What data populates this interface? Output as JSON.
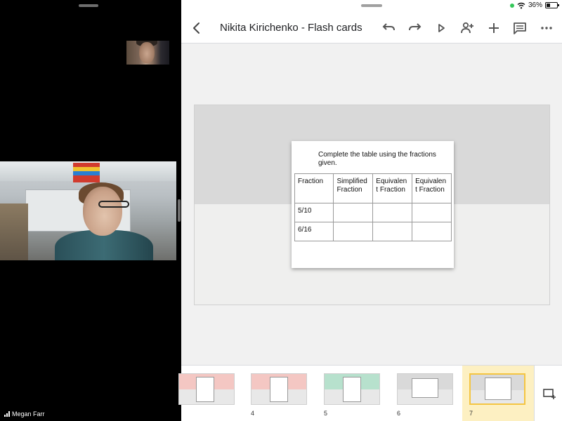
{
  "status_bar": {
    "battery": "36%"
  },
  "toolbar": {
    "title": "Nikita Kirichenko - Flash cards"
  },
  "icons": {
    "back": "chevron-left-icon",
    "undo": "undo-icon",
    "redo": "redo-icon",
    "present": "play-icon",
    "share": "person-add-icon",
    "add": "plus-icon",
    "comment": "comment-icon",
    "more": "more-horizontal-icon",
    "new_slide": "add-slide-icon"
  },
  "slide": {
    "instruction": "Complete the table using the fractions given.",
    "table": {
      "headers": [
        "Fraction",
        "Simplified Fraction",
        "Equivalen t Fraction",
        "Equivalen t Fraction"
      ],
      "rows": [
        [
          "5/10",
          "",
          "",
          ""
        ],
        [
          "6/16",
          "",
          "",
          ""
        ]
      ]
    }
  },
  "filmstrip": {
    "slides": [
      {
        "num": "",
        "band_color": "#f4c7c3"
      },
      {
        "num": "4",
        "band_color": "#f4c7c3"
      },
      {
        "num": "5",
        "band_color": "#b7e1cd"
      },
      {
        "num": "6",
        "band_color": "#d9d9d9"
      },
      {
        "num": "7",
        "band_color": "#d9d9d9",
        "selected": true
      }
    ]
  },
  "video": {
    "participant_name": "Megan Farr"
  },
  "colors": {
    "accent_selected": "#f4c542",
    "selected_bg": "#fdf0c2"
  }
}
